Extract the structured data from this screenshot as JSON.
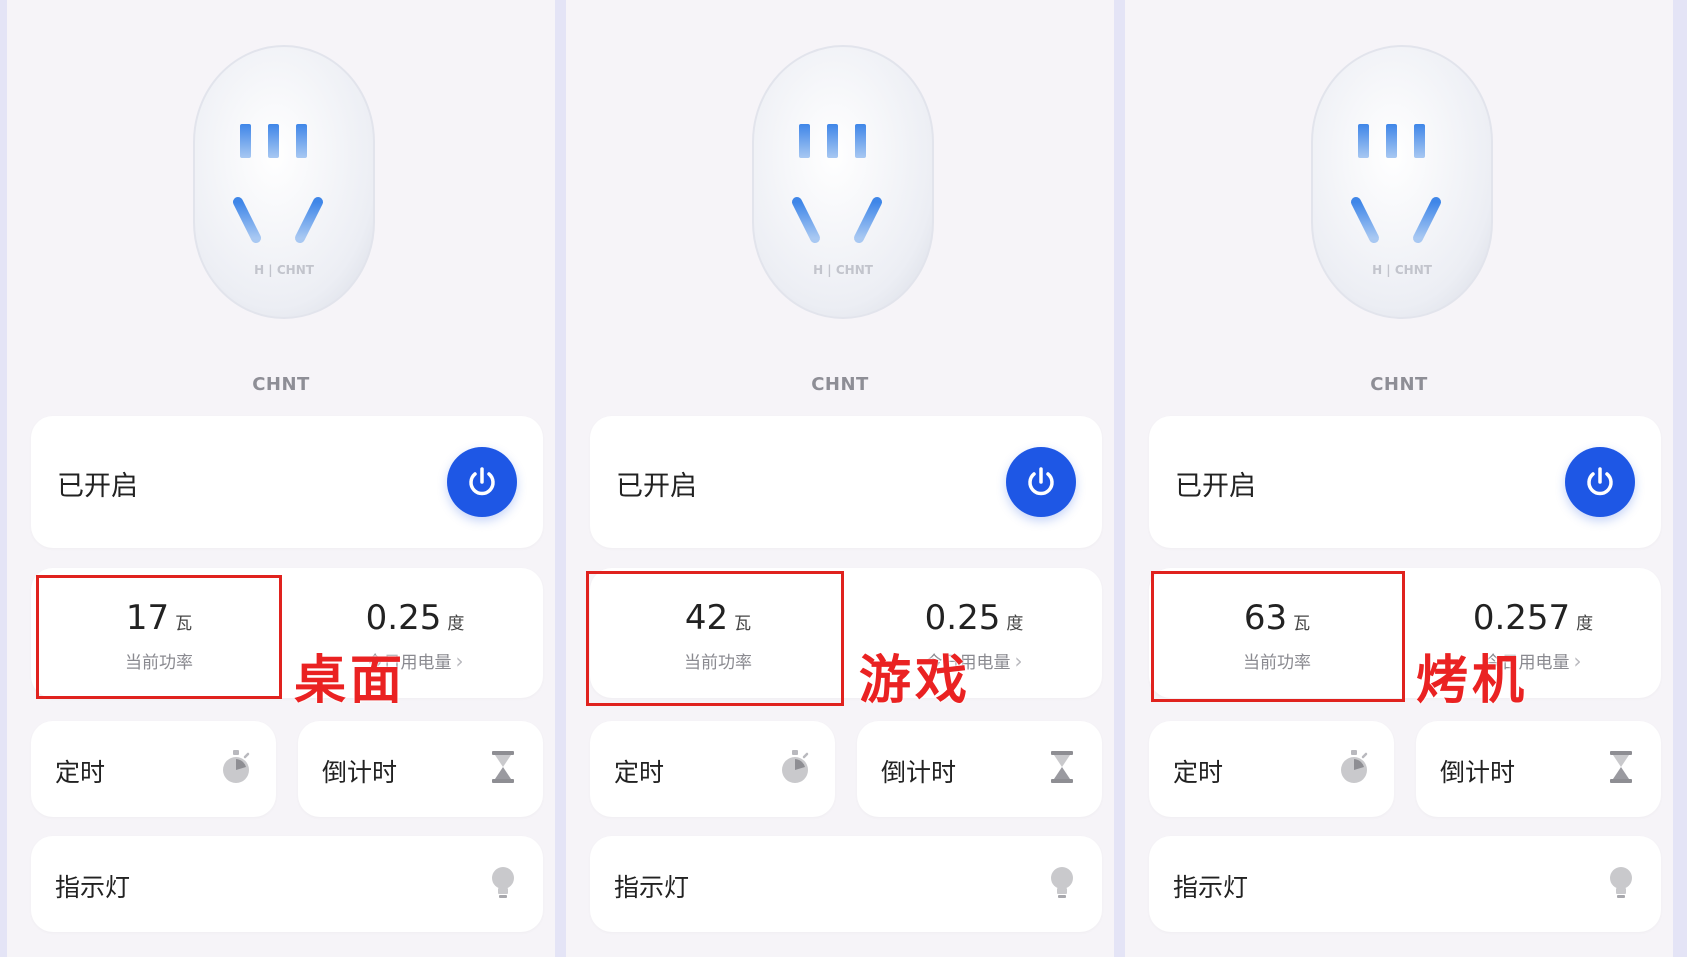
{
  "panels": [
    {
      "brand": "CHNT",
      "plug_logo": "H | CHNT",
      "status": "已开启",
      "power": {
        "value": "17",
        "unit": "瓦",
        "label": "当前功率"
      },
      "energy": {
        "value": "0.25",
        "unit": "度",
        "label": "今日用电量"
      },
      "timer_label": "定时",
      "countdown_label": "倒计时",
      "indicator_label": "指示灯",
      "overlay": "桌面"
    },
    {
      "brand": "CHNT",
      "plug_logo": "H | CHNT",
      "status": "已开启",
      "power": {
        "value": "42",
        "unit": "瓦",
        "label": "当前功率"
      },
      "energy": {
        "value": "0.25",
        "unit": "度",
        "label": "今日用电量"
      },
      "timer_label": "定时",
      "countdown_label": "倒计时",
      "indicator_label": "指示灯",
      "overlay": "游戏"
    },
    {
      "brand": "CHNT",
      "plug_logo": "H | CHNT",
      "status": "已开启",
      "power": {
        "value": "63",
        "unit": "瓦",
        "label": "当前功率"
      },
      "energy": {
        "value": "0.257",
        "unit": "度",
        "label": "今日用电量"
      },
      "timer_label": "定时",
      "countdown_label": "倒计时",
      "indicator_label": "指示灯",
      "overlay": "烤机"
    }
  ],
  "colors": {
    "accent": "#1e57e5",
    "highlight": "#e0221e",
    "background": "#f6f4f8"
  },
  "icons": {
    "power": "power-icon",
    "timer": "stopwatch-icon",
    "countdown": "hourglass-icon",
    "indicator": "light-bulb-icon",
    "chevron": "chevron-right-icon"
  }
}
